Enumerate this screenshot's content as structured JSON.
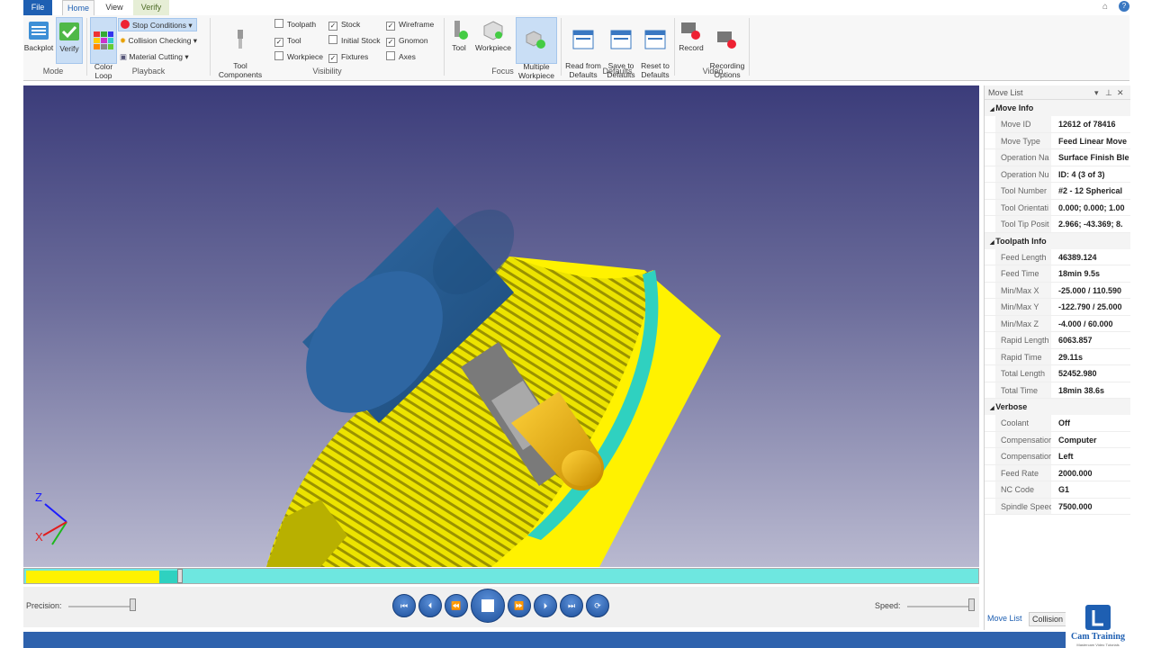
{
  "ribbon": {
    "tabs": [
      "File",
      "Home",
      "View",
      "Verify"
    ],
    "mode": {
      "backplot": "Backplot",
      "verify": "Verify",
      "group": "Mode"
    },
    "playback": {
      "color_loop": "Color\nLoop",
      "stop_conditions": "Stop Conditions",
      "collision_checking": "Collision Checking",
      "material_cutting": "Material Cutting",
      "group": "Playback"
    },
    "visibility": {
      "tool_components": "Tool\nComponents",
      "toolpath": "Toolpath",
      "tool": "Tool",
      "workpiece": "Workpiece",
      "stock": "Stock",
      "initial_stock": "Initial Stock",
      "fixtures": "Fixtures",
      "wireframe": "Wireframe",
      "gnomon": "Gnomon",
      "axes": "Axes",
      "group": "Visibility"
    },
    "focus": {
      "tool": "Tool",
      "workpiece": "Workpiece",
      "multiple": "Multiple\nWorkpiece",
      "group": "Focus"
    },
    "defaults": {
      "read": "Read from\nDefaults",
      "save": "Save to\nDefaults",
      "reset": "Reset to\nDefaults",
      "group": "Defaults"
    },
    "video": {
      "record": "Record",
      "options": "Recording\nOptions",
      "group": "Video"
    }
  },
  "playback_bar": {
    "precision_label": "Precision:",
    "speed_label": "Speed:",
    "progress": 0.16
  },
  "panel": {
    "title": "Move List",
    "sections": [
      {
        "title": "Move Info",
        "rows": [
          [
            "Move ID",
            "12612 of 78416"
          ],
          [
            "Move Type",
            "Feed Linear Move"
          ],
          [
            "Operation Na",
            "Surface Finish Ble"
          ],
          [
            "Operation Nu",
            "ID: 4 (3 of 3)"
          ],
          [
            "Tool Number",
            "#2 - 12 Spherical"
          ],
          [
            "Tool Orientati",
            "0.000; 0.000; 1.00"
          ],
          [
            "Tool Tip Posit",
            "2.966; -43.369; 8."
          ]
        ]
      },
      {
        "title": "Toolpath Info",
        "rows": [
          [
            "Feed Length",
            "46389.124"
          ],
          [
            "Feed Time",
            "18min 9.5s"
          ],
          [
            "Min/Max X",
            "-25.000 / 110.590"
          ],
          [
            "Min/Max Y",
            "-122.790 / 25.000"
          ],
          [
            "Min/Max Z",
            "-4.000 / 60.000"
          ],
          [
            "Rapid Length",
            "6063.857"
          ],
          [
            "Rapid Time",
            "29.11s"
          ],
          [
            "Total Length",
            "52452.980"
          ],
          [
            "Total Time",
            "18min 38.6s"
          ]
        ]
      },
      {
        "title": "Verbose",
        "rows": [
          [
            "Coolant",
            "Off"
          ],
          [
            "Compensatior",
            "Computer"
          ],
          [
            "Compensatior",
            "Left"
          ],
          [
            "Feed Rate",
            "2000.000"
          ],
          [
            "NC Code",
            "G1"
          ],
          [
            "Spindle Speec",
            "7500.000"
          ]
        ]
      }
    ],
    "bottom_tabs": [
      "Move List",
      "Collision"
    ]
  },
  "gnomon": {
    "z": "Z",
    "x": "X"
  },
  "brand": {
    "name": "Cam Training",
    "tagline": "Mastercam Video Tutorials"
  },
  "colors": {
    "accent": "#1e5fb2",
    "stock": "#fff200",
    "cut": "#2fd1c0",
    "tool_body": "#2b5f95",
    "tool_tip": "#e0a800"
  }
}
